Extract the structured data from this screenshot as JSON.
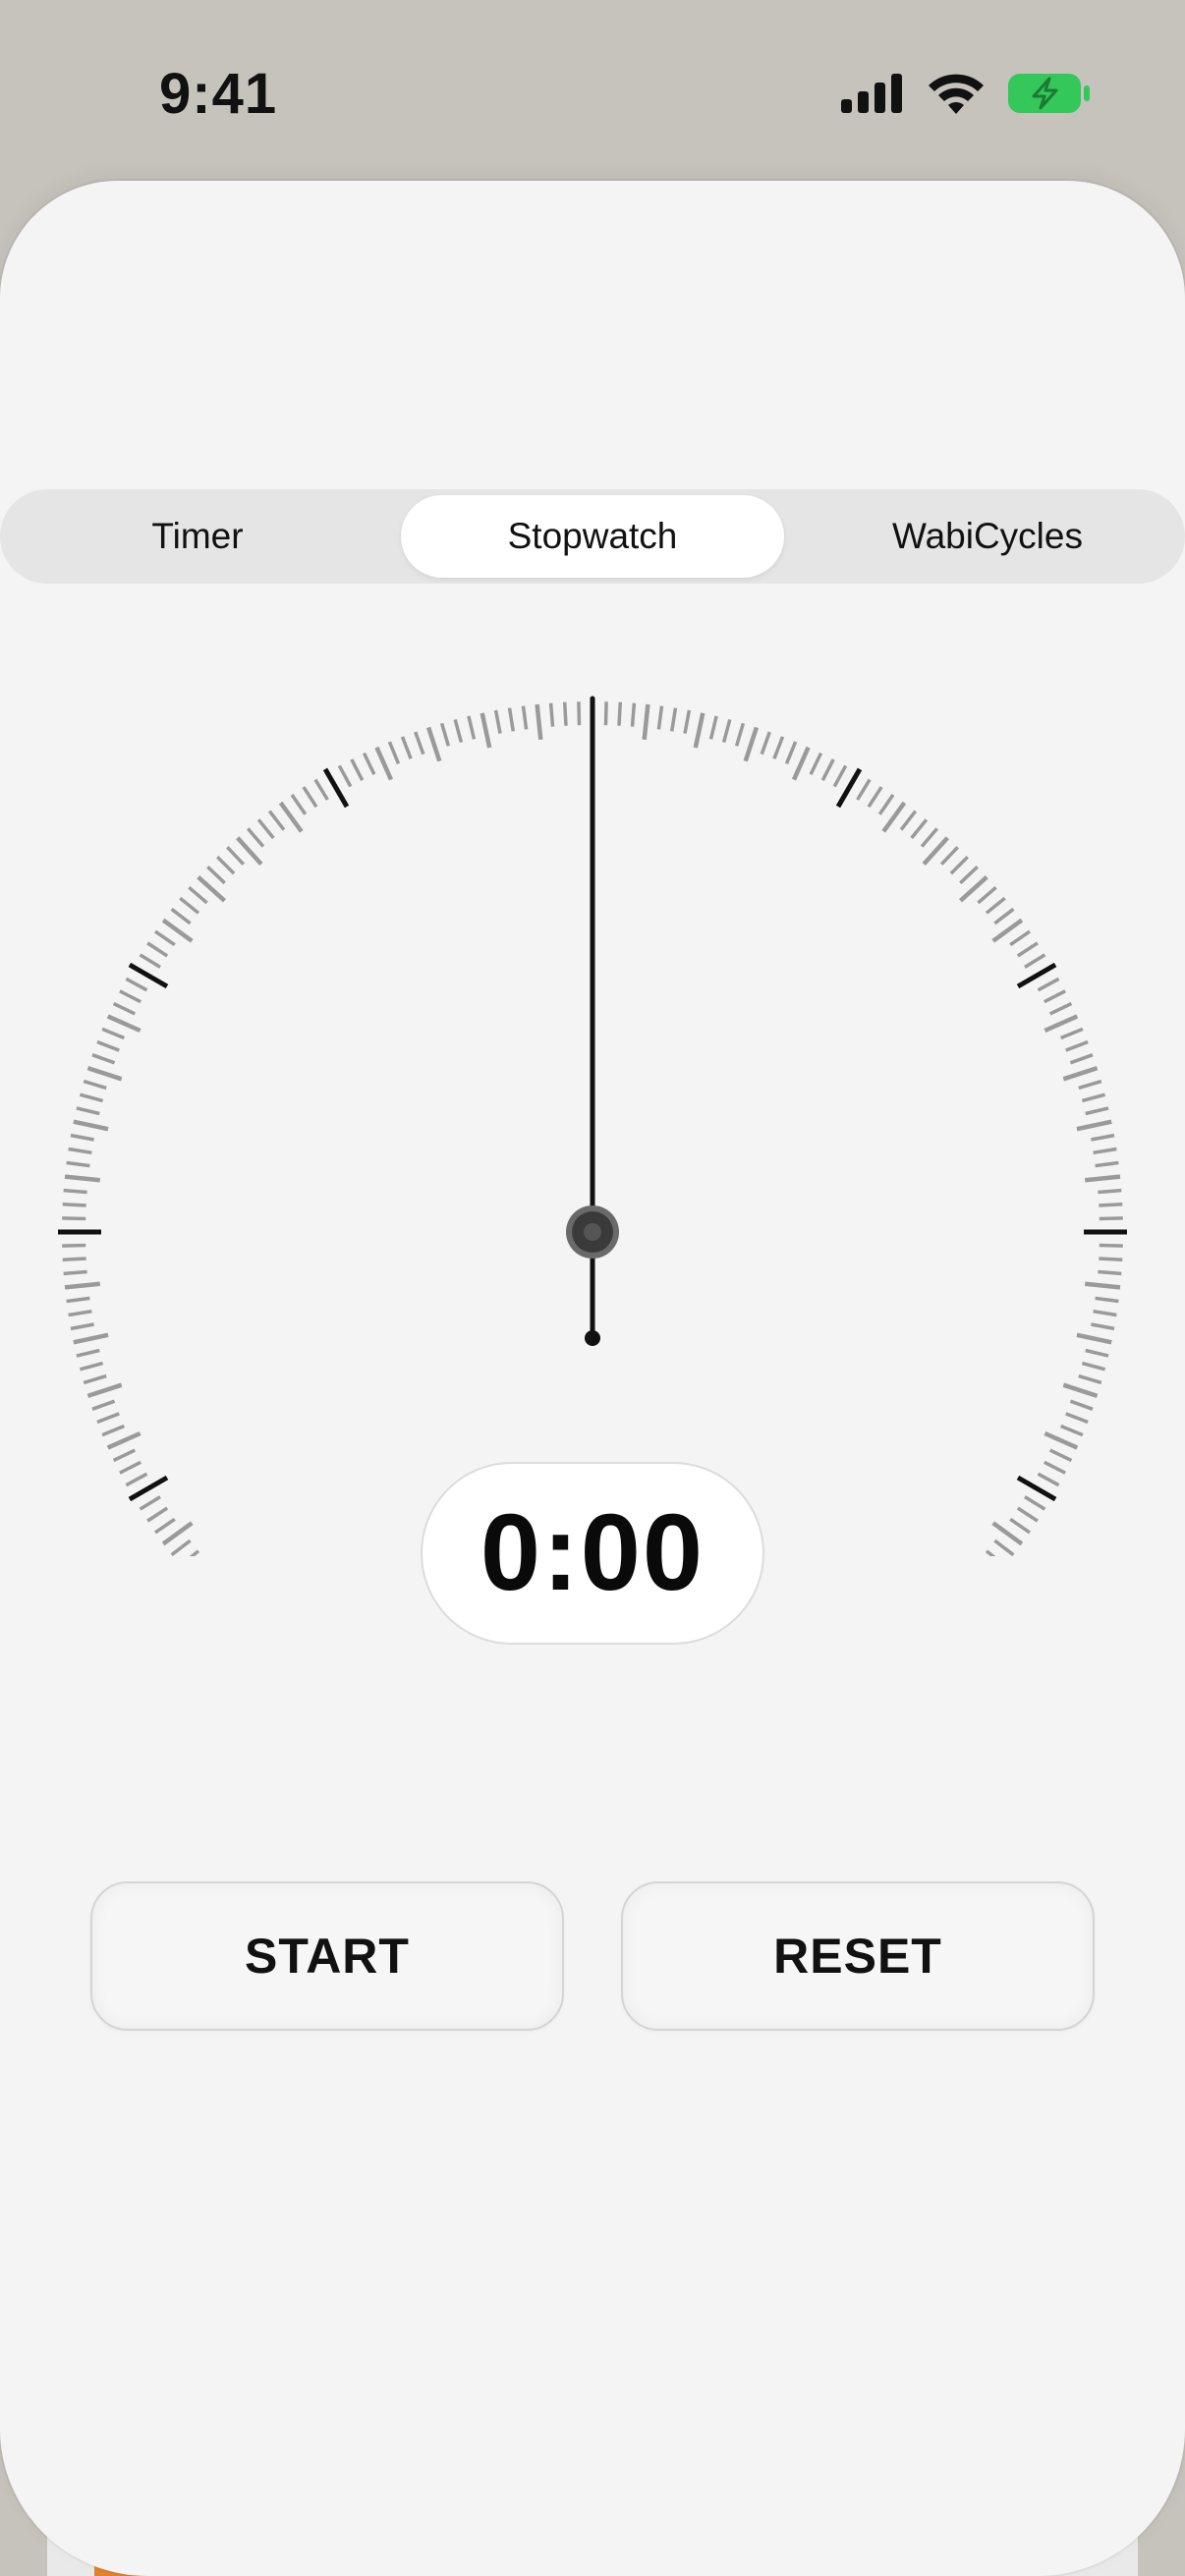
{
  "status_bar": {
    "time": "9:41",
    "icons": [
      "cellular-signal-icon",
      "wifi-icon",
      "battery-charging-icon"
    ],
    "battery_color": "#34c759"
  },
  "tabs": [
    {
      "label": "Timer",
      "selected": false
    },
    {
      "label": "Stopwatch",
      "selected": true
    },
    {
      "label": "WabiCycles",
      "selected": false
    }
  ],
  "stopwatch": {
    "elapsed": "0:00",
    "hand_position_seconds": 0
  },
  "buttons": {
    "start_label": "START",
    "reset_label": "RESET"
  },
  "colors": {
    "background": "#f4f4f4",
    "tick_minor": "#9a9a9a",
    "tick_major": "#111111",
    "accent_peek": "#e2832f"
  }
}
